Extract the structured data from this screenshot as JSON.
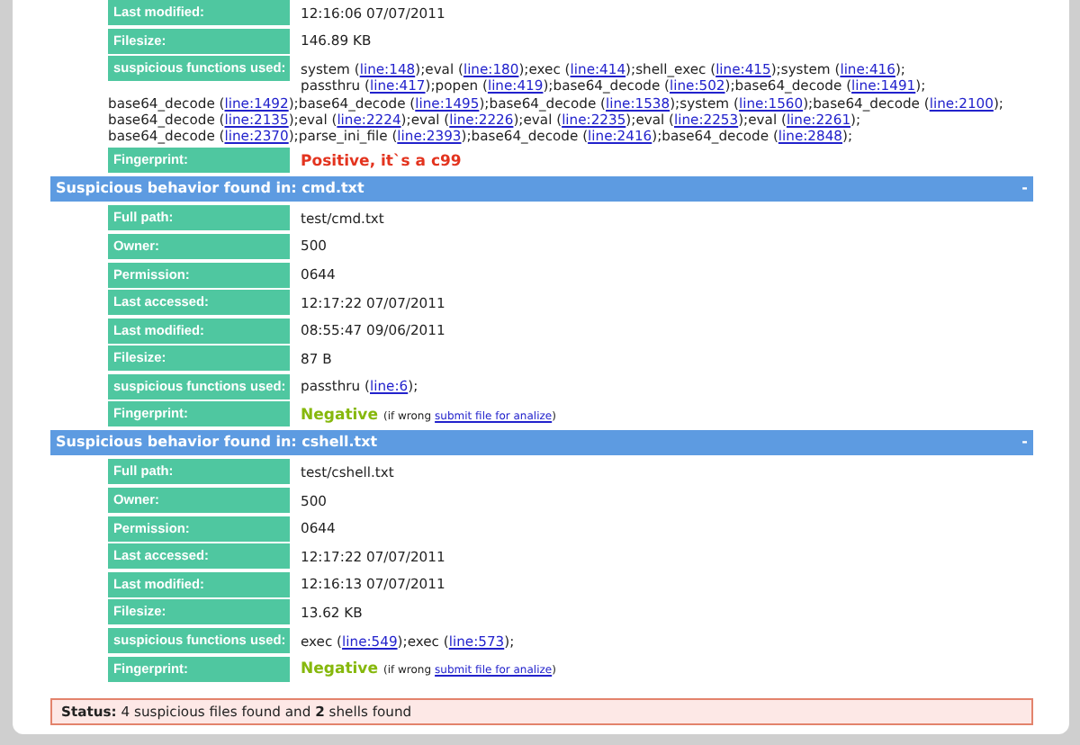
{
  "sections": [
    {
      "fields": [
        {
          "kind": "text",
          "label": "Last modified:",
          "value": "12:16:06 07/07/2011"
        },
        {
          "kind": "text",
          "label": "Filesize:",
          "value": "146.89 KB"
        },
        {
          "kind": "functions",
          "label": "suspicious functions used:",
          "items": [
            {
              "before": "system (",
              "link": "line:148",
              "after": ");"
            },
            {
              "before": "eval (",
              "link": "line:180",
              "after": ");"
            },
            {
              "before": "exec (",
              "link": "line:414",
              "after": ");"
            },
            {
              "before": "shell_exec (",
              "link": "line:415",
              "after": ");"
            },
            {
              "before": "system (",
              "link": "line:416",
              "after": ");"
            },
            {
              "before": "passthru (",
              "link": "line:417",
              "after": ");"
            },
            {
              "before": "popen (",
              "link": "line:419",
              "after": ");"
            },
            {
              "before": "base64_decode (",
              "link": "line:502",
              "after": ");"
            },
            {
              "before": "base64_decode (",
              "link": "line:1491",
              "after": ");"
            },
            {
              "before": "base64_decode (",
              "link": "line:1492",
              "after": ");"
            },
            {
              "before": "base64_decode (",
              "link": "line:1495",
              "after": ");"
            },
            {
              "before": "base64_decode (",
              "link": "line:1538",
              "after": ");"
            },
            {
              "before": "system (",
              "link": "line:1560",
              "after": ");"
            },
            {
              "before": "base64_decode (",
              "link": "line:2100",
              "after": ");"
            },
            {
              "before": "base64_decode (",
              "link": "line:2135",
              "after": ");"
            },
            {
              "before": "eval (",
              "link": "line:2224",
              "after": ");"
            },
            {
              "before": "eval (",
              "link": "line:2226",
              "after": ");"
            },
            {
              "before": "eval (",
              "link": "line:2235",
              "after": ");"
            },
            {
              "before": "eval (",
              "link": "line:2253",
              "after": ");"
            },
            {
              "before": "eval (",
              "link": "line:2261",
              "after": ");"
            },
            {
              "before": "base64_decode (",
              "link": "line:2370",
              "after": ");"
            },
            {
              "before": "parse_ini_file (",
              "link": "line:2393",
              "after": ");"
            },
            {
              "before": "base64_decode (",
              "link": "line:2416",
              "after": ");"
            },
            {
              "before": "base64_decode (",
              "link": "line:2848",
              "after": ");"
            }
          ]
        },
        {
          "kind": "fingerprint",
          "label": "Fingerprint:",
          "positive": true,
          "verdict": "Positive, it`s a c99"
        }
      ]
    },
    {
      "title": "Suspicious behavior found in: cmd.txt",
      "toggle": "-",
      "fields": [
        {
          "kind": "text",
          "label": "Full path:",
          "value": "test/cmd.txt"
        },
        {
          "kind": "text",
          "label": "Owner:",
          "value": "500"
        },
        {
          "kind": "text",
          "label": "Permission:",
          "value": "0644"
        },
        {
          "kind": "text",
          "label": "Last accessed:",
          "value": "12:17:22 07/07/2011"
        },
        {
          "kind": "text",
          "label": "Last modified:",
          "value": "08:55:47 09/06/2011"
        },
        {
          "kind": "text",
          "label": "Filesize:",
          "value": "87 B"
        },
        {
          "kind": "functions",
          "label": "suspicious functions used:",
          "items": [
            {
              "before": "passthru (",
              "link": "line:6",
              "after": ");"
            }
          ]
        },
        {
          "kind": "fingerprint",
          "label": "Fingerprint:",
          "positive": false,
          "verdict": "Negative",
          "note_before": "(if wrong",
          "link": "submit file for analize",
          "note_after": ")"
        }
      ]
    },
    {
      "title": "Suspicious behavior found in: cshell.txt",
      "toggle": "-",
      "fields": [
        {
          "kind": "text",
          "label": "Full path:",
          "value": "test/cshell.txt"
        },
        {
          "kind": "text",
          "label": "Owner:",
          "value": "500"
        },
        {
          "kind": "text",
          "label": "Permission:",
          "value": "0644"
        },
        {
          "kind": "text",
          "label": "Last accessed:",
          "value": "12:17:22 07/07/2011"
        },
        {
          "kind": "text",
          "label": "Last modified:",
          "value": "12:16:13 07/07/2011"
        },
        {
          "kind": "text",
          "label": "Filesize:",
          "value": "13.62 KB"
        },
        {
          "kind": "functions",
          "label": "suspicious functions used:",
          "items": [
            {
              "before": "exec (",
              "link": "line:549",
              "after": ");"
            },
            {
              "before": "exec (",
              "link": "line:573",
              "after": ");"
            }
          ]
        },
        {
          "kind": "fingerprint",
          "label": "Fingerprint:",
          "positive": false,
          "verdict": "Negative",
          "note_before": "(if wrong",
          "link": "submit file for analize",
          "note_after": ")"
        }
      ]
    }
  ],
  "status": "**Status:** 4 suspicious files found and **2** shells found"
}
